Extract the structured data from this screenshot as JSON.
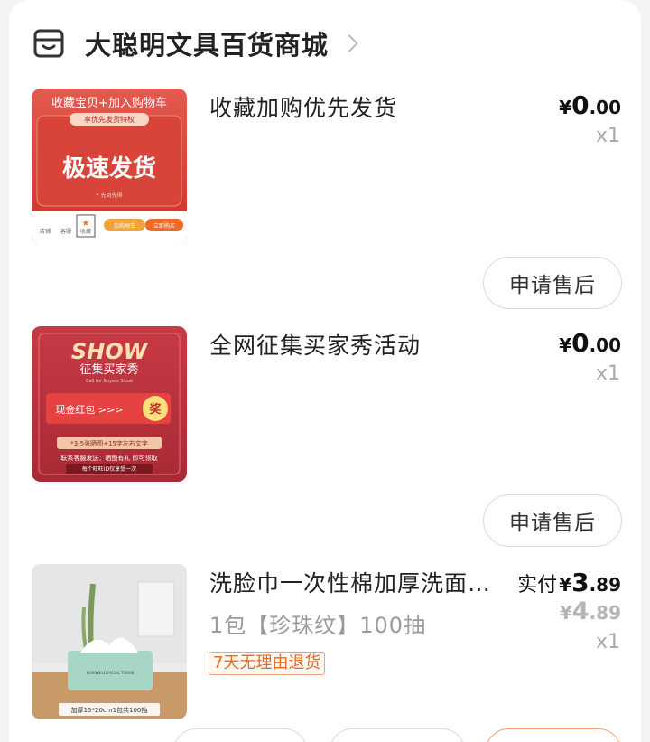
{
  "shop": {
    "name": "大聪明文具百货商城",
    "icon": "store-icon",
    "chevron": "chevron-right-icon"
  },
  "items": [
    {
      "title": "收藏加购优先发货",
      "price": {
        "currency": "¥",
        "int": "0",
        "dec": ".00"
      },
      "qty": "x1",
      "after_sale": "申请售后",
      "thumb": {
        "top_text": "收藏宝贝+加入购物车",
        "ribbon": "享优先发货特权",
        "main": "极速发货",
        "note": "* 先到先得",
        "bar": [
          "店铺",
          "客服",
          "收藏",
          "加购物车",
          "立即购买"
        ]
      }
    },
    {
      "title": "全网征集买家秀活动",
      "price": {
        "currency": "¥",
        "int": "0",
        "dec": ".00"
      },
      "qty": "x1",
      "after_sale": "申请售后",
      "thumb": {
        "show": "SHOW",
        "sub": "征集买家秀",
        "sub_en": "Call for Buyers Show",
        "pill": "现金红包 >>>",
        "prize": "奖",
        "req": "*3-5张晒图+15字左右文字",
        "contact": "联系客服发送：晒图有礼 即可领取",
        "limit": "每个旺旺ID仅享受一次"
      }
    },
    {
      "title": "洗脸巾一次性棉加厚洗面巾抽取式",
      "sku": "1包【珍珠纹】100抽",
      "badge": "7天无理由退货",
      "price": {
        "label": "实付",
        "currency": "¥",
        "int": "3",
        "dec": ".89"
      },
      "original": {
        "currency": "¥",
        "int": "4",
        "dec": ".89"
      },
      "qty": "x1",
      "thumb": {
        "caption": "加厚15*20cm1包共100抽",
        "pack_text": "BORNWILD  FACIAL TISSUE"
      }
    }
  ]
}
